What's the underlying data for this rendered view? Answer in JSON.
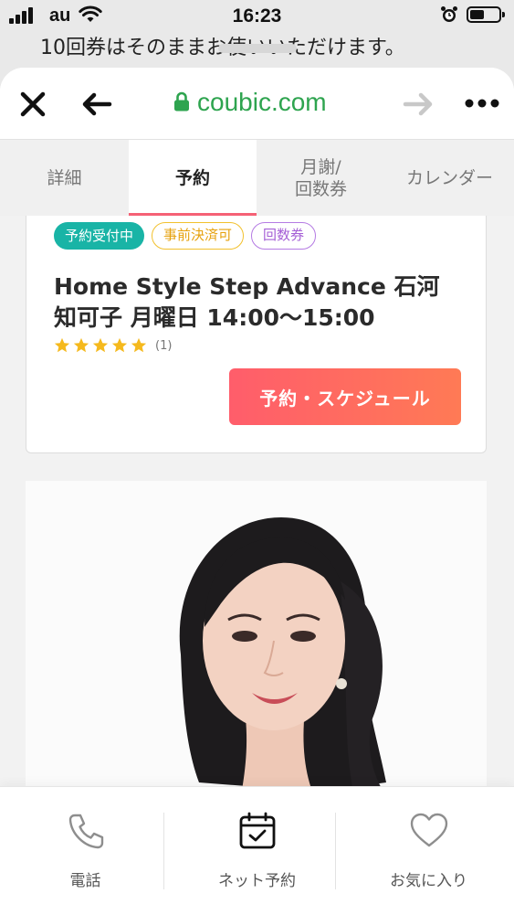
{
  "status_bar": {
    "carrier": "au",
    "time": "16:23"
  },
  "background_page": {
    "text": "10回券はそのままお使いいただけます。"
  },
  "browser": {
    "url": "coubic.com",
    "colors": {
      "url": "#2ea44f"
    }
  },
  "tabs": [
    {
      "label": "詳細",
      "active": false
    },
    {
      "label": "予約",
      "active": true
    },
    {
      "label": "月謝/\n回数券",
      "line1": "月謝/",
      "line2": "回数券",
      "active": false
    },
    {
      "label": "カレンダー",
      "active": false
    }
  ],
  "card": {
    "badges": [
      {
        "label": "予約受付中",
        "color": "#19b4a6"
      },
      {
        "label": "事前決済可",
        "color": "#f2c12e"
      },
      {
        "label": "回数券",
        "color": "#b57be3"
      }
    ],
    "title": "Home Style Step Advance 石河知可子 月曜日 14:00〜15:00",
    "rating_stars": 5,
    "rating_count": "(1)",
    "book_button": "予約・スケジュール",
    "accent_color": "#ff5d6b"
  },
  "bottom_bar": {
    "items": [
      {
        "label": "電話",
        "icon": "phone-icon"
      },
      {
        "label": "ネット予約",
        "icon": "calendar-check-icon"
      },
      {
        "label": "お気に入り",
        "icon": "heart-icon"
      }
    ]
  }
}
